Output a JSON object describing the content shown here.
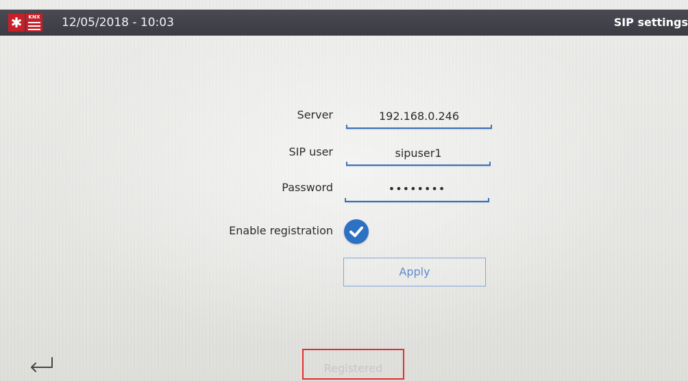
{
  "header": {
    "datetime": "12/05/2018 - 10:03",
    "title": "SIP settings",
    "logos": {
      "left": "snowflake-icon",
      "right": "KNX"
    }
  },
  "form": {
    "server": {
      "label": "Server",
      "value": "192.168.0.246"
    },
    "sip_user": {
      "label": "SIP user",
      "value": "sipuser1"
    },
    "password": {
      "label": "Password",
      "value": "••••••••"
    },
    "enable_registration": {
      "label": "Enable registration",
      "checked": true
    },
    "apply_label": "Apply"
  },
  "footer": {
    "back_icon": "return-arrow-icon",
    "status": "Registered"
  },
  "colors": {
    "header_bg": "#3f3f47",
    "accent_blue": "#2d71c2",
    "logo_red": "#c8202a",
    "highlight_red": "#e12f2f"
  }
}
